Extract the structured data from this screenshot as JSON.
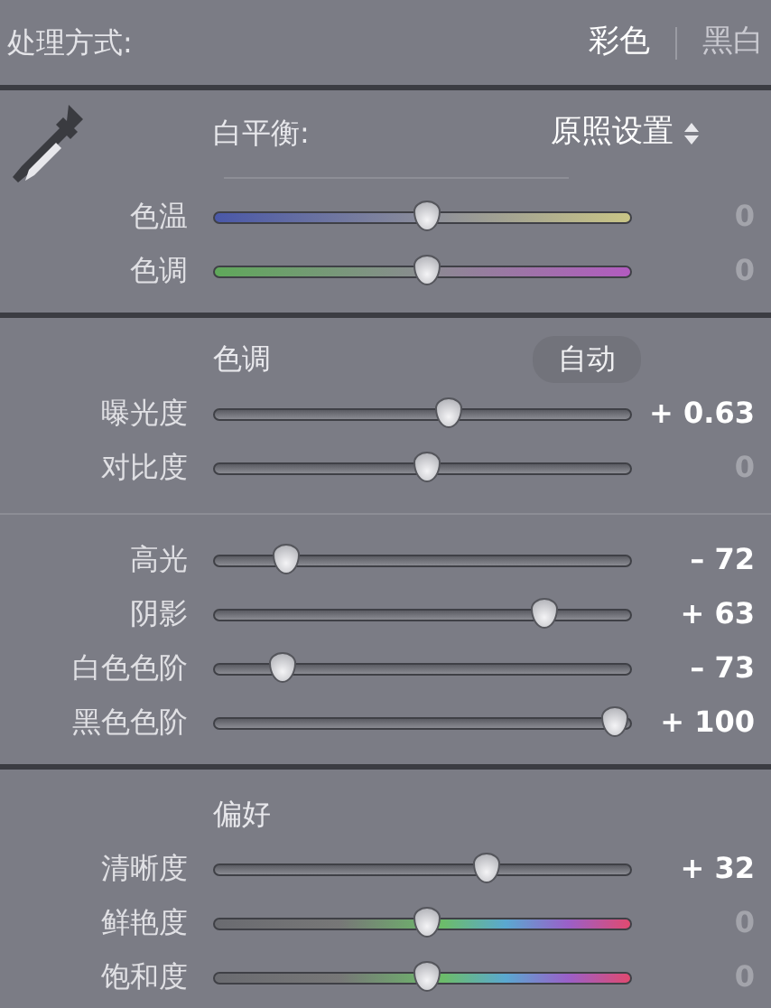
{
  "treatment": {
    "label": "处理方式:",
    "options": [
      {
        "label": "彩色",
        "selected": true
      },
      {
        "label": "黑白",
        "selected": false
      }
    ]
  },
  "white_balance": {
    "label": "白平衡:",
    "value": "原照设置",
    "sliders": [
      {
        "name": "色温",
        "kind": "temp",
        "level": 0.51,
        "reading": "0",
        "at_default": true
      },
      {
        "name": "色调",
        "kind": "tint",
        "level": 0.51,
        "reading": "0",
        "at_default": true
      }
    ]
  },
  "tone": {
    "title": "色调",
    "auto_button": "自动",
    "groups": [
      [
        {
          "name": "曝光度",
          "kind": "plain",
          "level": 0.56,
          "reading": "+ 0.63",
          "at_default": false
        },
        {
          "name": "对比度",
          "kind": "plain",
          "level": 0.51,
          "reading": "0",
          "at_default": true
        }
      ],
      [
        {
          "name": "高光",
          "kind": "plain",
          "level": 0.17,
          "reading": "– 72",
          "at_default": false
        },
        {
          "name": "阴影",
          "kind": "plain",
          "level": 0.79,
          "reading": "+ 63",
          "at_default": false
        },
        {
          "name": "白色色阶",
          "kind": "plain",
          "level": 0.16,
          "reading": "– 73",
          "at_default": false
        },
        {
          "name": "黑色色阶",
          "kind": "plain",
          "level": 0.96,
          "reading": "+ 100",
          "at_default": false
        }
      ]
    ]
  },
  "presence": {
    "title": "偏好",
    "sliders": [
      {
        "name": "清晰度",
        "kind": "plain",
        "level": 0.65,
        "reading": "+ 32",
        "at_default": false
      },
      {
        "name": "鲜艳度",
        "kind": "vibrance",
        "level": 0.51,
        "reading": "0",
        "at_default": true
      },
      {
        "name": "饱和度",
        "kind": "vibrance",
        "level": 0.51,
        "reading": "0",
        "at_default": true
      }
    ]
  }
}
